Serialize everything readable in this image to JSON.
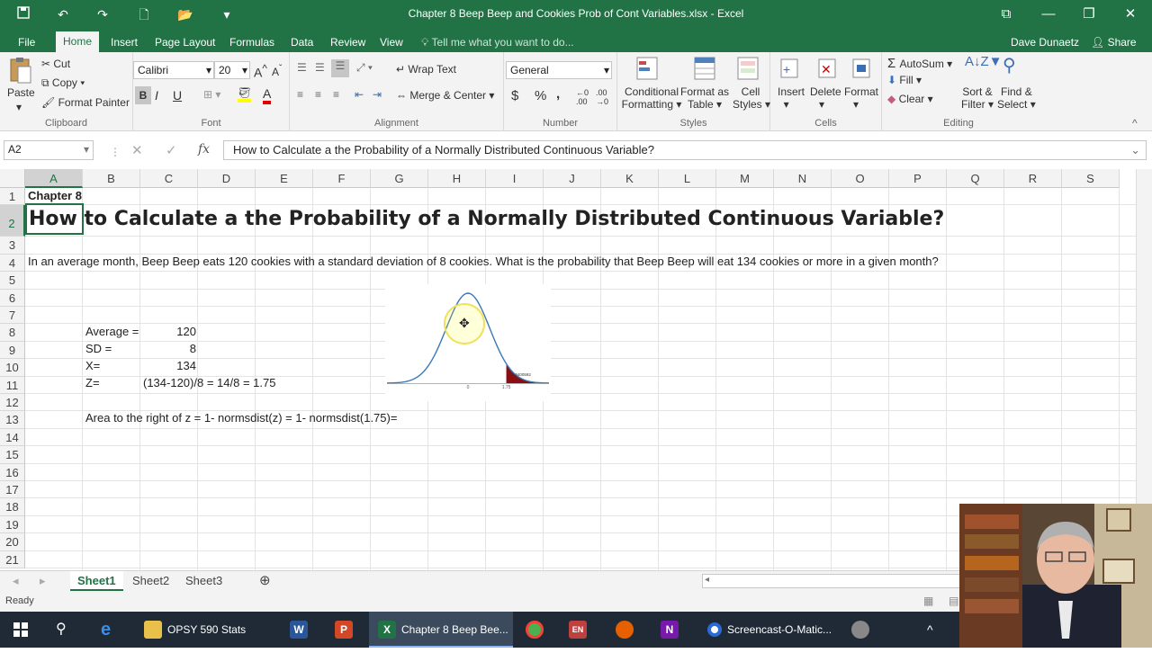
{
  "window": {
    "title": "Chapter 8 Beep Beep and Cookies Prob of Cont Variables.xlsx - Excel",
    "accent": "#217346"
  },
  "quick_access": [
    "save-icon",
    "undo-icon",
    "redo-icon",
    "new-icon",
    "open-icon",
    "customize-icon"
  ],
  "menu": {
    "tabs": [
      "File",
      "Home",
      "Insert",
      "Page Layout",
      "Formulas",
      "Data",
      "Review",
      "View"
    ],
    "active": "Home",
    "tell_me": "Tell me what you want to do...",
    "user": "Dave Dunaetz",
    "share": "Share"
  },
  "ribbon": {
    "clipboard": {
      "paste": "Paste",
      "cut": "Cut",
      "copy": "Copy",
      "format_painter": "Format Painter",
      "label": "Clipboard"
    },
    "font": {
      "name": "Calibri",
      "size": "20",
      "label": "Font",
      "bold": "B",
      "italic": "I",
      "underline": "U"
    },
    "alignment": {
      "wrap": "Wrap Text",
      "merge": "Merge & Center",
      "label": "Alignment"
    },
    "number": {
      "format": "General",
      "currency": "$",
      "percent": "%",
      "comma": ",",
      "label": "Number"
    },
    "styles": {
      "conditional": "Conditional",
      "conditional2": "Formatting",
      "format_table": "Format as",
      "format_table2": "Table",
      "cell_styles": "Cell",
      "cell_styles2": "Styles",
      "label": "Styles"
    },
    "cells": {
      "insert": "Insert",
      "delete": "Delete",
      "format": "Format",
      "label": "Cells"
    },
    "editing": {
      "autosum": "AutoSum",
      "fill": "Fill",
      "clear": "Clear",
      "sort": "Sort &",
      "sort2": "Filter",
      "find": "Find &",
      "find2": "Select",
      "label": "Editing"
    }
  },
  "formula_bar": {
    "name_box": "A2",
    "formula": "How to Calculate a the Probability of a Normally Distributed Continuous Variable?"
  },
  "columns": [
    "A",
    "B",
    "C",
    "D",
    "E",
    "F",
    "G",
    "H",
    "I",
    "J",
    "K",
    "L",
    "M",
    "N",
    "O",
    "P",
    "Q",
    "R",
    "S"
  ],
  "rows": [
    "1",
    "2",
    "3",
    "4",
    "5",
    "6",
    "7",
    "8",
    "9",
    "10",
    "11",
    "12",
    "13",
    "14",
    "15",
    "16",
    "17",
    "18",
    "19",
    "20",
    "21"
  ],
  "cells": {
    "A1": "Chapter 8",
    "A2": "How to Calculate a the Probability of a Normally Distributed Continuous Variable?",
    "A4": "In an average month, Beep Beep eats 120 cookies with a standard deviation of 8 cookies. What is the probability that Beep Beep will eat 134 cookies or more in a given month?",
    "B8": "Average =",
    "C8": "120",
    "B9": "SD =",
    "C9": "8",
    "B10": "X=",
    "C10": "134",
    "B11": "Z=",
    "C11": "(134-120)/8 = 14/8 = 1.75",
    "B13": "Area to the right of z = 1- normsdist(z) = 1- normsdist(1.75)="
  },
  "chart_data": {
    "type": "area",
    "x_ticks": [
      "0",
      "1.75"
    ],
    "shaded_from": 1.75,
    "annotation": "0.0400592"
  },
  "sheets": [
    "Sheet1",
    "Sheet2",
    "Sheet3"
  ],
  "active_sheet": "Sheet1",
  "status": "Ready",
  "taskbar": {
    "items": [
      "OPSY 590 Stats",
      "Chapter 8 Beep Bee...",
      "Screencast-O-Matic..."
    ]
  }
}
